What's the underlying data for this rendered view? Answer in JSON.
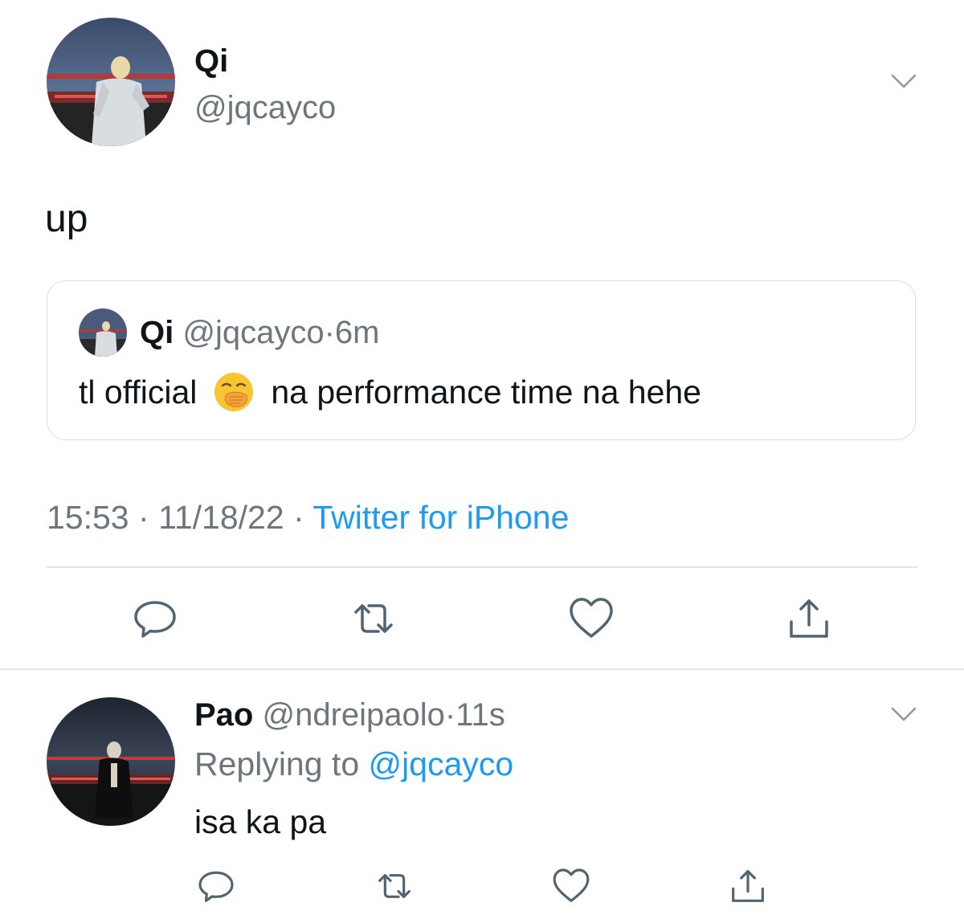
{
  "main_tweet": {
    "display_name": "Qi",
    "handle": "@jqcayco",
    "text": "up",
    "timestamp": "15:53",
    "date": "11/18/22",
    "separator": "·",
    "source": "Twitter for iPhone",
    "menu_icon": "chevron-down-icon"
  },
  "quoted_tweet": {
    "display_name": "Qi",
    "handle": "@jqcayco",
    "separator": "·",
    "time": "6m",
    "text_before": "tl official",
    "emoji": "face-with-hand-over-mouth-emoji",
    "text_after": "na performance time na hehe"
  },
  "actions": {
    "reply_icon": "reply-icon",
    "retweet_icon": "retweet-icon",
    "like_icon": "heart-icon",
    "share_icon": "share-icon"
  },
  "reply_tweet": {
    "display_name": "Pao",
    "handle": "@ndreipaolo",
    "separator": "·",
    "time": "11s",
    "replying_label": "Replying to",
    "replying_to": "@jqcayco",
    "text": "isa ka pa",
    "menu_icon": "chevron-down-icon"
  },
  "colors": {
    "text": "#0f1419",
    "secondary_text": "#6e767d",
    "link": "#1d9bf0",
    "border": "#d7dde2",
    "icon": "#536471"
  }
}
